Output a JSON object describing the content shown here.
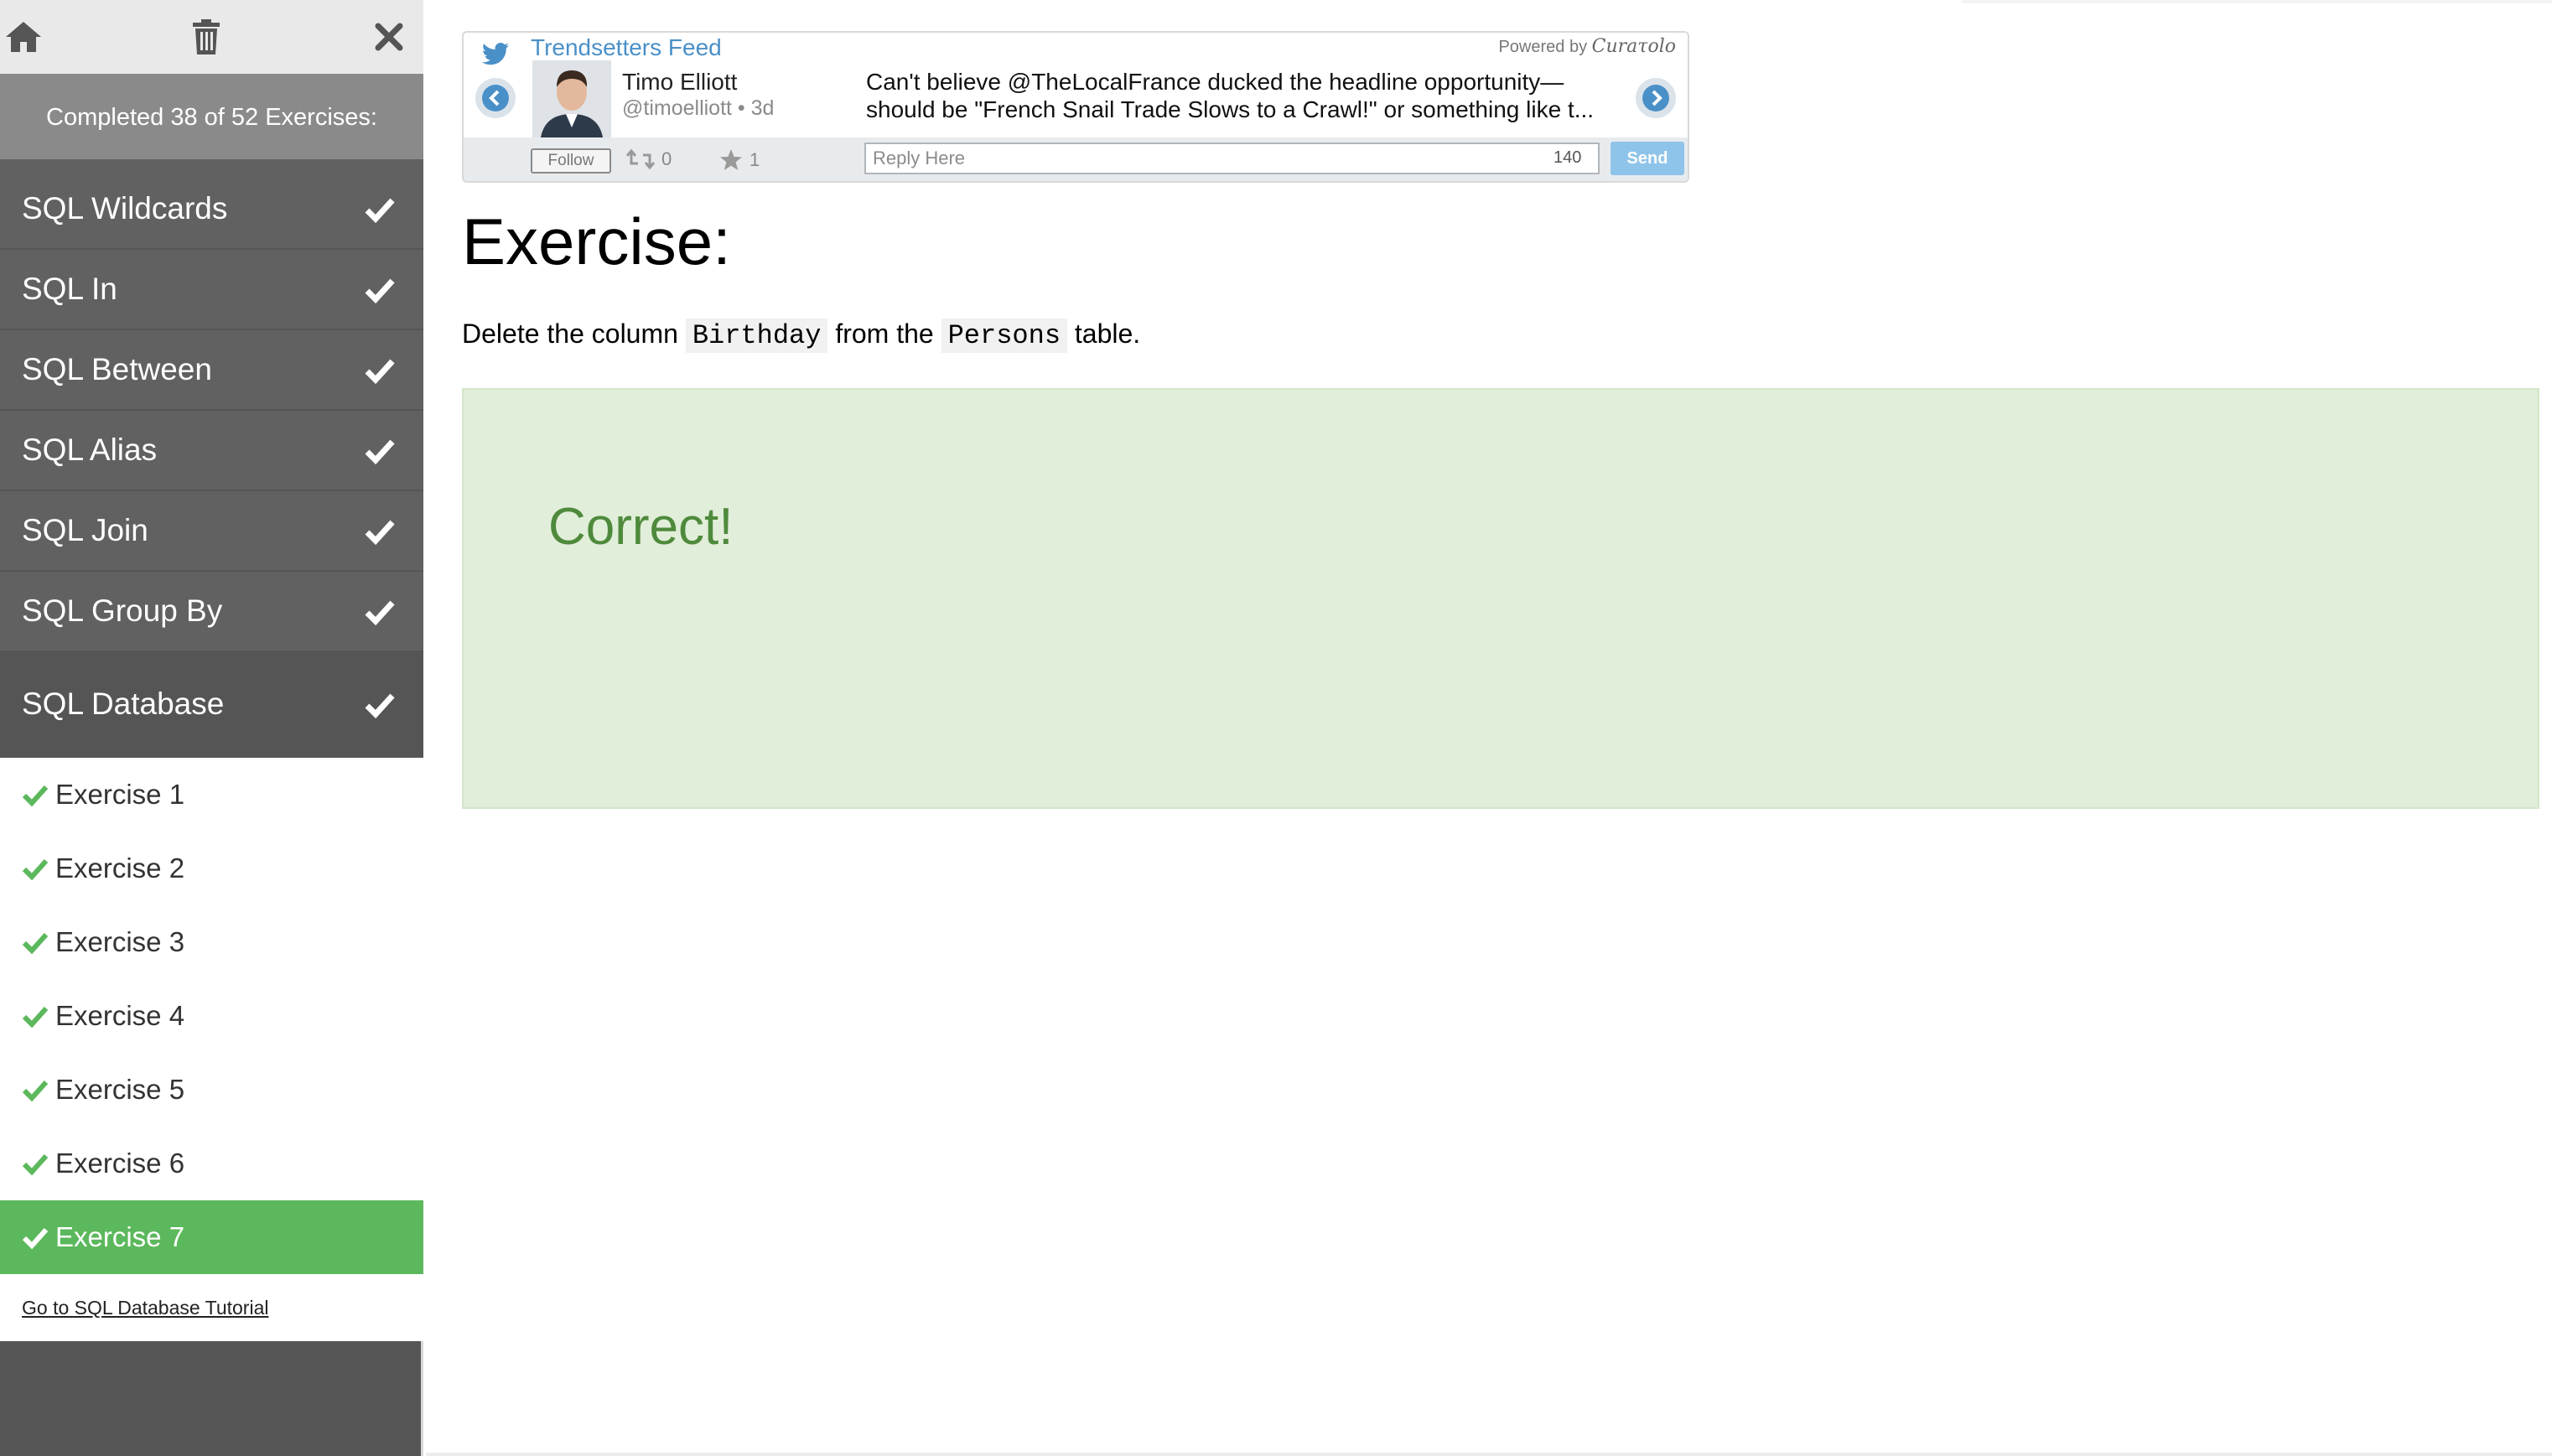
{
  "topbar": {
    "icons": [
      "home-icon",
      "trash-icon",
      "close-icon"
    ]
  },
  "sidebar": {
    "completed_text": "Completed 38 of 52 Exercises:",
    "categories": [
      {
        "label": "SQL Wildcards"
      },
      {
        "label": "SQL In"
      },
      {
        "label": "SQL Between"
      },
      {
        "label": "SQL Alias"
      },
      {
        "label": "SQL Join"
      },
      {
        "label": "SQL Group By"
      },
      {
        "label": "SQL Database"
      }
    ],
    "exercises": [
      {
        "label": "Exercise 1"
      },
      {
        "label": "Exercise 2"
      },
      {
        "label": "Exercise 3"
      },
      {
        "label": "Exercise 4"
      },
      {
        "label": "Exercise 5"
      },
      {
        "label": "Exercise 6"
      },
      {
        "label": "Exercise 7"
      }
    ],
    "tutorial_link": "Go to SQL Database Tutorial"
  },
  "twitter": {
    "feed_title": "Trendsetters Feed",
    "powered_by": "Powered by",
    "brand": "Curaτοlο",
    "name": "Timo Elliott",
    "handle": "@timoelliott • 3d",
    "text_line1": "Can't believe @TheLocalFrance ducked the headline opportunity—",
    "text_line2": "should be \"French Snail Trade Slows to a Crawl!\" or something like t...",
    "follow": "Follow",
    "retweets": "0",
    "favorites": "1",
    "reply_placeholder": "Reply Here",
    "char_count": "140",
    "send": "Send"
  },
  "main": {
    "title": "Exercise:",
    "desc_before": "Delete the column",
    "code1": "Birthday",
    "desc_middle": "from the",
    "code2": "Persons",
    "desc_after": "table.",
    "result_text": "Correct!"
  },
  "colors": {
    "accent_green": "#5cb85c",
    "sidebar_bg": "#616161",
    "result_bg": "#e1eed9",
    "result_text": "#4f8a3c",
    "twitter_blue": "#4a90c8"
  }
}
